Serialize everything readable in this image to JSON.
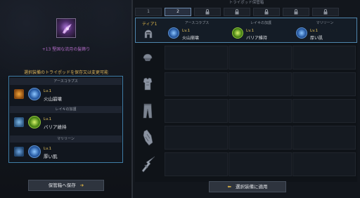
{
  "left": {
    "item_name": "+13 堅固な流月の髪飾り",
    "warning": "選択装備のトライポッドを保存又は変更可能",
    "tripods": [
      {
        "category": "アースコラプス",
        "level": "Lv.1",
        "skill": "火山崩壊",
        "equip_icon": "ring-icon",
        "skill_icon": "fire-skill-icon"
      },
      {
        "category": "レイキの加護",
        "level": "Lv.1",
        "skill": "バリア維持",
        "equip_icon": "armor-icon",
        "skill_icon": "barrier-skill-icon"
      },
      {
        "category": "マリリーン",
        "level": "Lv.1",
        "skill": "厚い肌",
        "equip_icon": "boots-icon",
        "skill_icon": "skin-skill-icon"
      }
    ],
    "save_button": "保管箱へ保存",
    "save_arrow": "➔"
  },
  "right": {
    "title": "トライポッド保管箱",
    "tabs": [
      {
        "label": "1",
        "state": "normal"
      },
      {
        "label": "2",
        "state": "active"
      },
      {
        "label": "",
        "state": "locked"
      },
      {
        "label": "",
        "state": "locked"
      },
      {
        "label": "",
        "state": "locked"
      },
      {
        "label": "",
        "state": "locked"
      },
      {
        "label": "",
        "state": "locked"
      }
    ],
    "tier_label": "ティア1",
    "columns": [
      "アースコラプス",
      "レイキの加護",
      "マリリーン"
    ],
    "first_row": [
      {
        "level": "Lv.1",
        "skill": "火山崩壊"
      },
      {
        "level": "Lv.1",
        "skill": "バリア維持"
      },
      {
        "level": "Lv.1",
        "skill": "厚い肌"
      }
    ],
    "slots": [
      "helmet-icon",
      "shoulder-icon",
      "chest-icon",
      "pants-icon",
      "gloves-icon",
      "weapon-icon"
    ],
    "apply_button": "選択装備に適用",
    "apply_arrow": "⬅"
  },
  "colors": {
    "accent": "#4f86ad",
    "gold": "#e5c25c",
    "purple": "#b46cc9"
  }
}
